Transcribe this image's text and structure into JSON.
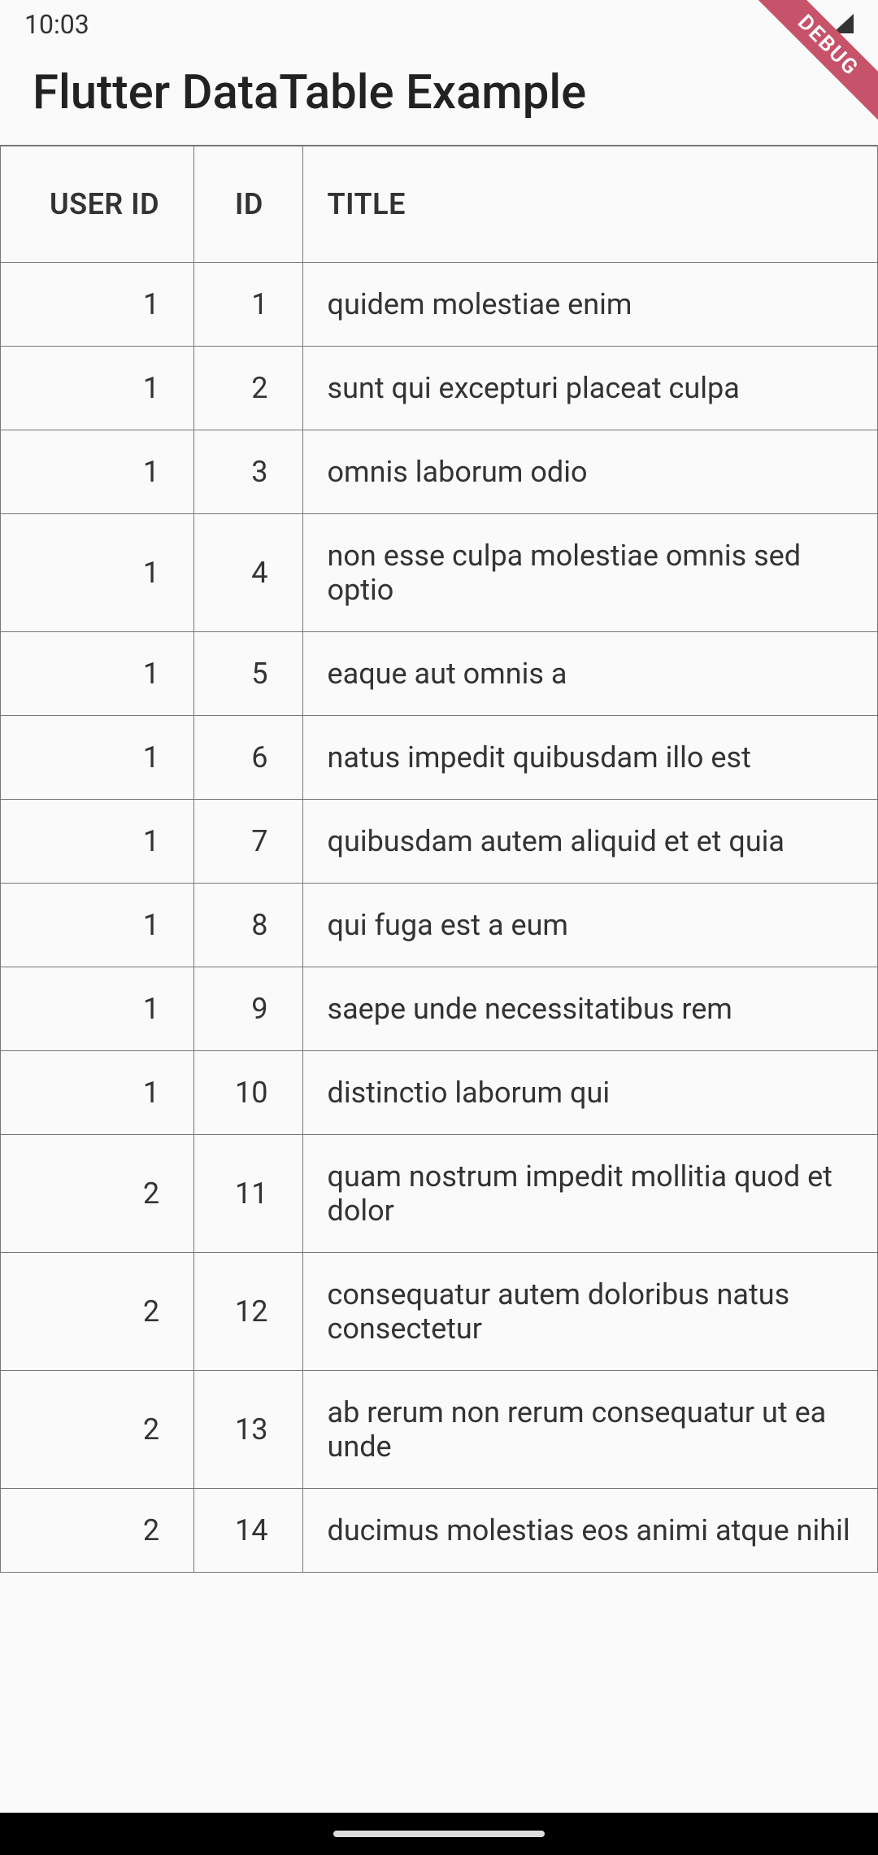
{
  "status": {
    "time": "10:03",
    "debug_label": "DEBUG"
  },
  "app": {
    "title": "Flutter DataTable Example"
  },
  "table": {
    "headers": {
      "user_id": "USER ID",
      "id": "ID",
      "title": "TITLE"
    },
    "rows": [
      {
        "user_id": "1",
        "id": "1",
        "title": "quidem molestiae enim"
      },
      {
        "user_id": "1",
        "id": "2",
        "title": "sunt qui excepturi placeat culpa"
      },
      {
        "user_id": "1",
        "id": "3",
        "title": "omnis laborum odio"
      },
      {
        "user_id": "1",
        "id": "4",
        "title": "non esse culpa molestiae omnis sed optio"
      },
      {
        "user_id": "1",
        "id": "5",
        "title": "eaque aut omnis a"
      },
      {
        "user_id": "1",
        "id": "6",
        "title": "natus impedit quibusdam illo est"
      },
      {
        "user_id": "1",
        "id": "7",
        "title": "quibusdam autem aliquid et et quia"
      },
      {
        "user_id": "1",
        "id": "8",
        "title": "qui fuga est a eum"
      },
      {
        "user_id": "1",
        "id": "9",
        "title": "saepe unde necessitatibus rem"
      },
      {
        "user_id": "1",
        "id": "10",
        "title": "distinctio laborum qui"
      },
      {
        "user_id": "2",
        "id": "11",
        "title": "quam nostrum impedit mollitia quod et dolor"
      },
      {
        "user_id": "2",
        "id": "12",
        "title": "consequatur autem doloribus natus consectetur"
      },
      {
        "user_id": "2",
        "id": "13",
        "title": "ab rerum non rerum consequatur ut ea unde"
      },
      {
        "user_id": "2",
        "id": "14",
        "title": "ducimus molestias eos animi atque nihil"
      }
    ]
  }
}
